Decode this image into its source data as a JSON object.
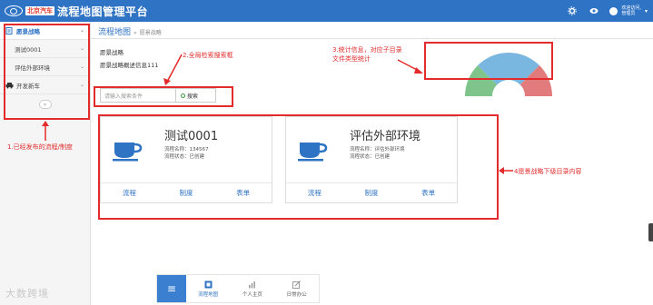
{
  "header": {
    "brand": "北京汽车",
    "title": "流程地图管理平台",
    "user_line1": "欢迎访问,",
    "user_line2": "管理员"
  },
  "sidebar": {
    "items": [
      {
        "label": "愿景战略",
        "active": true
      },
      {
        "label": "测试0001"
      },
      {
        "label": "评估外部环境"
      },
      {
        "label": "开发新车"
      }
    ],
    "collapse_symbol": "«"
  },
  "breadcrumb": {
    "main": "流程地图",
    "sep": "»",
    "current": "愿景战略"
  },
  "info": {
    "title": "愿景战略",
    "desc": "愿景战略概述信息111"
  },
  "search": {
    "placeholder": "请输入搜索条件",
    "button": "搜索"
  },
  "cards": [
    {
      "title": "测试0001",
      "name_line": "流程名称：134567",
      "status_line": "流程状态：已创建",
      "links": [
        "流程",
        "制度",
        "表单"
      ]
    },
    {
      "title": "评估外部环境",
      "name_line": "流程名称：评估外部环境",
      "status_line": "流程状态：已创建",
      "links": [
        "流程",
        "制度",
        "表单"
      ]
    }
  ],
  "gauge": {
    "segments": [
      {
        "color": "#7fc48a",
        "share": 0.25
      },
      {
        "color": "#7ab7e0",
        "share": 0.5
      },
      {
        "color": "#e27b7b",
        "share": 0.25
      }
    ]
  },
  "annotations": {
    "a1": "1.已经发布的流程/制度",
    "a2": "2.全局检索搜索框",
    "a3": "3.统计信息，对应子目录",
    "a3b": "文件类型统计",
    "a4": "4愿景战略下级目录内容"
  },
  "dock": {
    "menu_symbol": "≡",
    "items": [
      {
        "label": "流程地图",
        "active": true
      },
      {
        "label": "个人主页"
      },
      {
        "label": "日常办公"
      }
    ]
  },
  "watermark": "大数跨境",
  "colors": {
    "primary": "#2f73c4",
    "annotation": "#e32b2b"
  }
}
